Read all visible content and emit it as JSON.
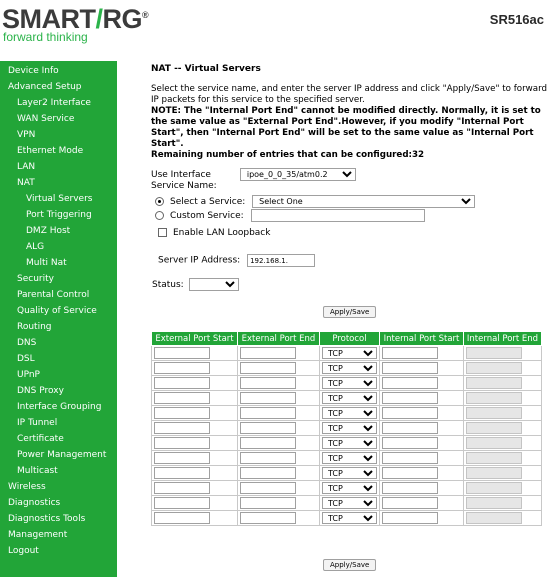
{
  "header": {
    "logo_text": "SMART",
    "logo_slash": "/",
    "logo_text2": "RG",
    "logo_reg": "®",
    "tagline": "forward thinking",
    "model": "SR516ac"
  },
  "sidebar": {
    "items": [
      {
        "label": "Device Info",
        "level": 0
      },
      {
        "label": "Advanced Setup",
        "level": 0
      },
      {
        "label": "Layer2 Interface",
        "level": 1
      },
      {
        "label": "WAN Service",
        "level": 1
      },
      {
        "label": "VPN",
        "level": 1
      },
      {
        "label": "Ethernet Mode",
        "level": 1
      },
      {
        "label": "LAN",
        "level": 1
      },
      {
        "label": "NAT",
        "level": 1
      },
      {
        "label": "Virtual Servers",
        "level": 2
      },
      {
        "label": "Port Triggering",
        "level": 2
      },
      {
        "label": "DMZ Host",
        "level": 2
      },
      {
        "label": "ALG",
        "level": 2
      },
      {
        "label": "Multi Nat",
        "level": 2
      },
      {
        "label": "Security",
        "level": 1
      },
      {
        "label": "Parental Control",
        "level": 1
      },
      {
        "label": "Quality of Service",
        "level": 1
      },
      {
        "label": "Routing",
        "level": 1
      },
      {
        "label": "DNS",
        "level": 1
      },
      {
        "label": "DSL",
        "level": 1
      },
      {
        "label": "UPnP",
        "level": 1
      },
      {
        "label": "DNS Proxy",
        "level": 1
      },
      {
        "label": "Interface Grouping",
        "level": 1
      },
      {
        "label": "IP Tunnel",
        "level": 1
      },
      {
        "label": "Certificate",
        "level": 1
      },
      {
        "label": "Power Management",
        "level": 1
      },
      {
        "label": "Multicast",
        "level": 1
      },
      {
        "label": "Wireless",
        "level": 0
      },
      {
        "label": "Diagnostics",
        "level": 0
      },
      {
        "label": "Diagnostics Tools",
        "level": 0
      },
      {
        "label": "Management",
        "level": 0
      },
      {
        "label": "Logout",
        "level": 0
      }
    ]
  },
  "main": {
    "title": "NAT -- Virtual Servers",
    "desc_line1": "Select the service name, and enter the server IP address and click \"Apply/Save\" to forward IP packets for this service to the specified server.",
    "desc_note": "NOTE: The \"Internal Port End\" cannot be modified directly. Normally, it is set to the same value as \"External Port End\".However, if you modify \"Internal Port Start\", then \"Internal Port End\" will be set to the same value as \"Internal Port Start\".",
    "desc_remaining": "Remaining number of entries that can be configured:32",
    "use_interface_label": "Use Interface",
    "use_interface_value": "ipoe_0_0_35/atm0.2",
    "service_name_label": "Service Name:",
    "select_service_label": "Select a Service:",
    "select_service_value": "Select One",
    "custom_service_label": "Custom Service:",
    "lan_loopback_label": "Enable LAN Loopback",
    "server_ip_label": "Server IP Address:",
    "server_ip_value": "192.168.1.",
    "status_label": "Status:",
    "status_value": "",
    "apply_label": "Apply/Save"
  },
  "table": {
    "headers": [
      "External Port Start",
      "External Port End",
      "Protocol",
      "Internal Port Start",
      "Internal Port End"
    ],
    "protocol_default": "TCP",
    "row_count": 12
  },
  "colors": {
    "brand_green": "#22a538",
    "logo_gray": "#3b3b3b"
  }
}
